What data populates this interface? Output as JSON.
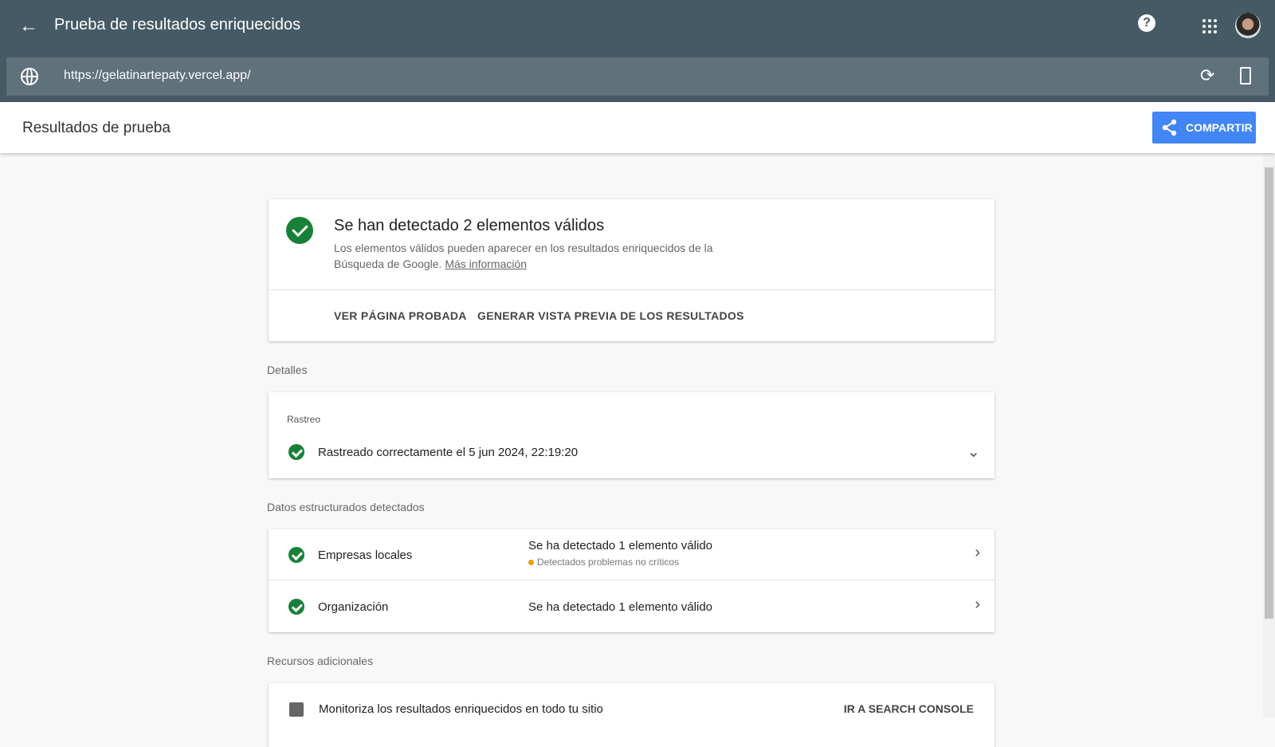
{
  "header": {
    "title": "Prueba de resultados enriquecidos",
    "back_icon": "arrow-left-icon",
    "help_icon": "help-icon",
    "apps_icon": "apps-grid-icon"
  },
  "url_bar": {
    "url": "https://gelatinartepaty.vercel.app/",
    "reload_icon": "reload-icon",
    "device_icon": "smartphone-icon"
  },
  "subheader": {
    "title": "Resultados de prueba",
    "share_label": "COMPARTIR"
  },
  "summary": {
    "title": "Se han detectado 2 elementos válidos",
    "description": "Los elementos válidos pueden aparecer en los resultados enriquecidos de la Búsqueda de Google.",
    "link": "Más información",
    "action1": "VER PÁGINA PROBADA",
    "action2": "GENERAR VISTA PREVIA DE LOS RESULTADOS"
  },
  "details": {
    "section": "Detalles",
    "label": "Rastreo",
    "status": "Rastreado correctamente el 5 jun 2024, 22:19:20"
  },
  "structured": {
    "section": "Datos estructurados detectados",
    "items": [
      {
        "name": "Empresas locales",
        "status": "Se ha detectado 1 elemento válido",
        "warning": "Detectados problemas no críticos"
      },
      {
        "name": "Organización",
        "status": "Se ha detectado 1 elemento válido"
      }
    ]
  },
  "resources": {
    "section": "Recursos adicionales",
    "text": "Monitoriza los resultados enriquecidos en todo tu sitio",
    "action": "IR A SEARCH CONSOLE"
  },
  "colors": {
    "header": "#455a64",
    "accent": "#4285f4",
    "valid": "#188038",
    "warning": "#f29900"
  }
}
